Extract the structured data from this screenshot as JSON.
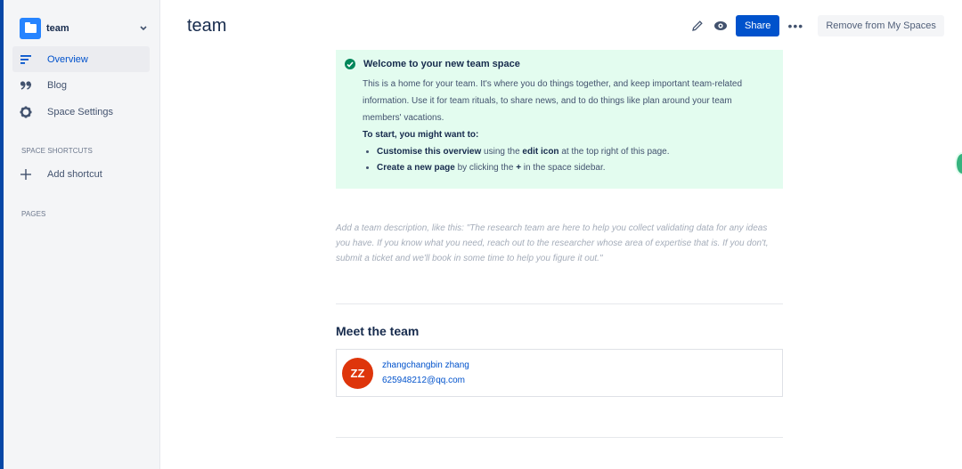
{
  "sidebar": {
    "space_name": "team",
    "nav": [
      {
        "label": "Overview",
        "icon": "overview-icon",
        "active": true
      },
      {
        "label": "Blog",
        "icon": "quote-icon",
        "active": false
      },
      {
        "label": "Space Settings",
        "icon": "gear-icon",
        "active": false
      }
    ],
    "shortcuts_label": "SPACE SHORTCUTS",
    "add_shortcut_label": "Add shortcut",
    "pages_label": "PAGES"
  },
  "header": {
    "title": "team",
    "share_label": "Share",
    "more_label": "•••",
    "remove_label": "Remove from My Spaces"
  },
  "welcome": {
    "title": "Welcome to your new team space",
    "body": "This is a home for your team. It's where you do things together, and keep important team-related information. Use it for team rituals, to share news, and to do things like plan around your team members' vacations.",
    "subtitle": "To start, you might want to:",
    "items": [
      {
        "bold": "Customise this overview",
        "text1": " using the ",
        "bold2": "edit icon",
        "text2": " at the top right of this page."
      },
      {
        "bold": "Create a new page",
        "text1": " by clicking the ",
        "bold2": "+",
        "text2": " in the space sidebar."
      }
    ]
  },
  "description_placeholder": "Add a team description, like this: \"The research team are here to help you collect validating data for any ideas you have. If you know what you need, reach out to the researcher whose area of expertise that is. If you don't, submit a ticket and we'll book in some time to help you figure it out.\"",
  "team": {
    "heading": "Meet the team",
    "members": [
      {
        "initials": "ZZ",
        "name": "zhangchangbin zhang",
        "email": "625948212@qq.com",
        "avatar_color": "#de350b"
      }
    ]
  },
  "colors": {
    "primary": "#0052cc",
    "success_bg": "#e3fcef",
    "success_icon": "#00875a"
  }
}
